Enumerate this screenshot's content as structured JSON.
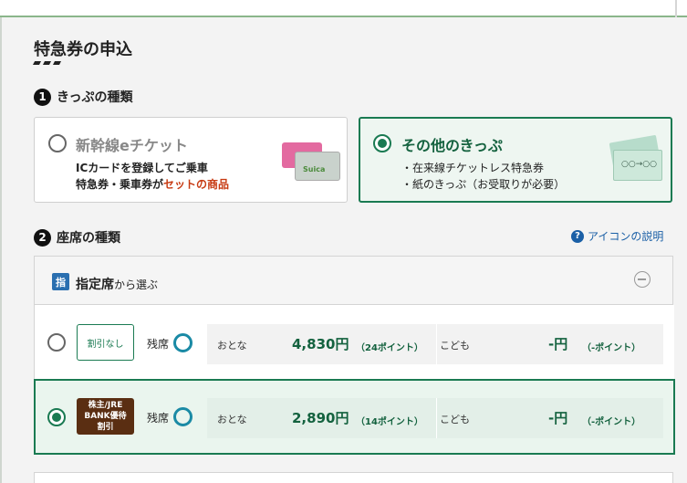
{
  "page_title": "特急券の申込",
  "step1": {
    "number": "1",
    "label": "きっぷの種類",
    "options": [
      {
        "title": "新幹線eチケット",
        "line1": "ICカードを登録してご乗車",
        "line2_prefix": "特急券・乗車券が",
        "line2_highlight": "セットの商品",
        "card_label": "Suica",
        "selected": false
      },
      {
        "title": "その他のきっぷ",
        "bullets": [
          "・在来線チケットレス特急券",
          "・紙のきっぷ（お受取りが必要）"
        ],
        "ticket_label": "○○→○○",
        "selected": true
      }
    ]
  },
  "step2": {
    "number": "2",
    "label": "座席の種類",
    "help_link": "アイコンの説明",
    "help_icon": "?",
    "section": {
      "badge": "指",
      "title": "指定席",
      "title_suffix": "から選ぶ",
      "collapse_icon": "minus-circle-icon"
    },
    "fares": [
      {
        "type_label": "割引なし",
        "availability": "残席",
        "adult_label": "おとな",
        "adult_price": "4,830円",
        "adult_points": "（24ポイント）",
        "child_label": "こども",
        "child_price": "-円",
        "child_points": "（-ポイント）",
        "selected": false
      },
      {
        "type_label_lines": [
          "株主/JRE",
          "BANK優待",
          "割引"
        ],
        "availability": "残席",
        "adult_label": "おとな",
        "adult_price": "2,890円",
        "adult_points": "（14ポイント）",
        "child_label": "こども",
        "child_price": "-円",
        "child_points": "（-ポイント）",
        "selected": true
      }
    ]
  },
  "colors": {
    "accent_green": "#1a7a52",
    "price_green": "#14623f",
    "highlight_red": "#c73a12",
    "link_blue": "#1a5fa6",
    "discount_brown": "#5a2e12"
  }
}
